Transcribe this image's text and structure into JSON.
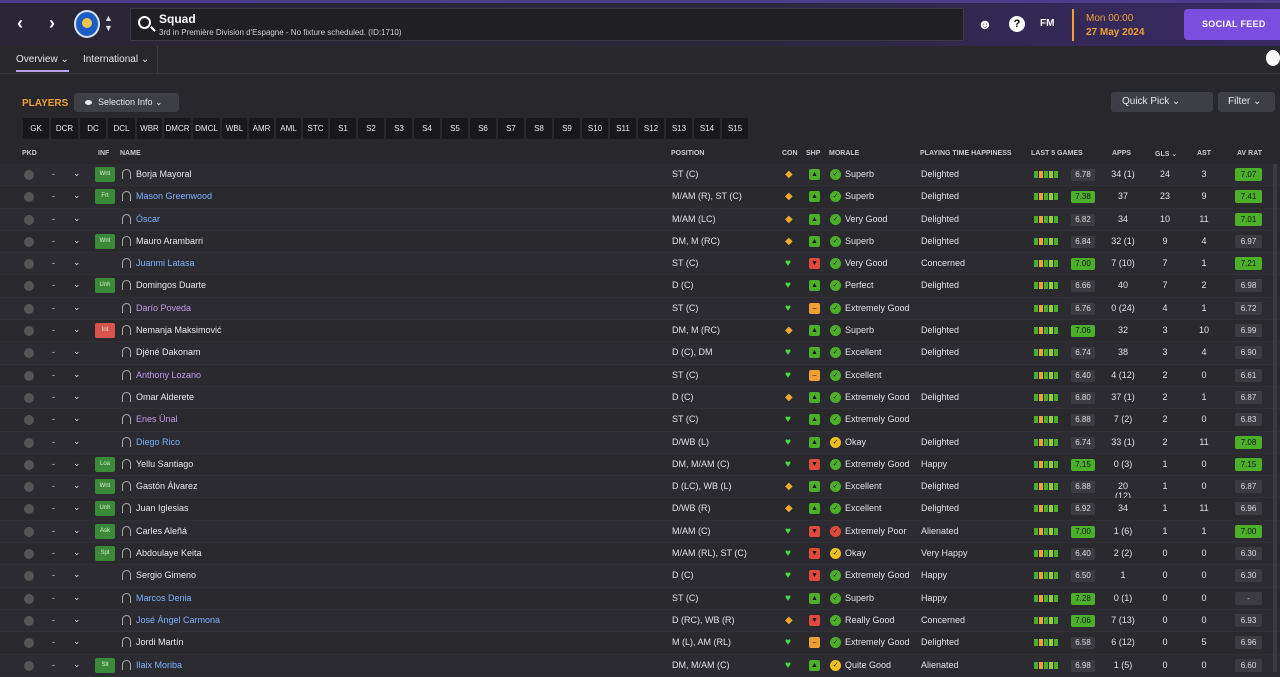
{
  "header": {
    "title": "Squad",
    "subtitle": "3rd in Première Division d'Espagne - No fixture scheduled. (ID:1710)",
    "fm_label": "FM",
    "help_label": "?",
    "date_line1": "Mon 00:00",
    "date_line2": "27 May 2024",
    "social_label": "SOCIAL FEED",
    "back_label": "‹",
    "forward_label": "›"
  },
  "tabs": [
    {
      "label": "Overview ⌄"
    },
    {
      "label": "International ⌄"
    }
  ],
  "toolbar": {
    "players_label": "PLAYERS",
    "selection_info": "Selection Info ⌄",
    "quick_pick": "Quick Pick   ⌄",
    "filter": "Filter ⌄"
  },
  "position_filters": [
    "GK",
    "DCR",
    "DC",
    "DCL",
    "WBR",
    "DMCR",
    "DMCL",
    "WBL",
    "AMR",
    "AML",
    "STC",
    "S1",
    "S2",
    "S3",
    "S4",
    "S5",
    "S6",
    "S7",
    "S8",
    "S9",
    "S10",
    "S11",
    "S12",
    "S13",
    "S14",
    "S15"
  ],
  "columns": {
    "pkd": "PKD",
    "inf": "INF",
    "name": "NAME",
    "position": "POSITION",
    "con": "CON",
    "shp": "SHP",
    "morale": "MORALE",
    "pth": "PLAYING TIME HAPPINESS",
    "last5": "LAST 5 GAMES",
    "apps": "APPS",
    "gls": "GLS ⌄",
    "ast": "AST",
    "avrat": "AV RAT"
  },
  "colors": {
    "accent": "#f0a030",
    "social": "#7c4ee0",
    "green": "#4caf2a",
    "red": "#e04a3a",
    "name_blue": "#7db3ff",
    "name_purple": "#c49cf0"
  },
  "players": [
    {
      "inf": "Wnt",
      "name": "Borja Mayoral",
      "name_color": "white",
      "position": "ST (C)",
      "con": "shield",
      "shp": "up",
      "morale": "Superb",
      "pth": "Delighted",
      "last5": "6.78",
      "apps": "34 (1)",
      "gls": "24",
      "ast": "3",
      "avrat": "7.07"
    },
    {
      "inf": "Frt",
      "name": "Mason Greenwood",
      "name_color": "blue",
      "position": "M/AM (R), ST (C)",
      "con": "shield",
      "shp": "up",
      "morale": "Superb",
      "pth": "Delighted",
      "last5": "7.38",
      "apps": "37",
      "gls": "23",
      "ast": "9",
      "avrat": "7.41"
    },
    {
      "inf": "",
      "name": "Óscar",
      "name_color": "blue",
      "position": "M/AM (LC)",
      "con": "shield",
      "shp": "up",
      "morale": "Very Good",
      "pth": "Delighted",
      "last5": "6.82",
      "apps": "34",
      "gls": "10",
      "ast": "11",
      "avrat": "7.01"
    },
    {
      "inf": "Wnt",
      "name": "Mauro Arambarri",
      "name_color": "white",
      "position": "DM, M (RC)",
      "con": "shield",
      "shp": "up",
      "morale": "Superb",
      "pth": "Delighted",
      "last5": "6.84",
      "apps": "32 (1)",
      "gls": "9",
      "ast": "4",
      "avrat": "6.97"
    },
    {
      "inf": "",
      "name": "Juanmi Latasa",
      "name_color": "blue",
      "position": "ST (C)",
      "con": "heart",
      "shp": "down",
      "morale": "Very Good",
      "pth": "Concerned",
      "last5": "7.00",
      "apps": "7 (10)",
      "gls": "7",
      "ast": "1",
      "avrat": "7.21"
    },
    {
      "inf": "Unh",
      "name": "Domingos Duarte",
      "name_color": "white",
      "position": "D (C)",
      "con": "heart",
      "shp": "up",
      "morale": "Perfect",
      "pth": "Delighted",
      "last5": "6.66",
      "apps": "40",
      "gls": "7",
      "ast": "2",
      "avrat": "6.98"
    },
    {
      "inf": "",
      "name": "Darío Poveda",
      "name_color": "purple",
      "position": "ST (C)",
      "con": "heart",
      "shp": "neutral",
      "morale": "Extremely Good",
      "pth": "",
      "last5": "6.76",
      "apps": "0 (24)",
      "gls": "4",
      "ast": "1",
      "avrat": "6.72"
    },
    {
      "inf": "Int",
      "name": "Nemanja Maksimović",
      "name_color": "white",
      "position": "DM, M (RC)",
      "con": "shield",
      "shp": "up",
      "morale": "Superb",
      "pth": "Delighted",
      "last5": "7.06",
      "apps": "32",
      "gls": "3",
      "ast": "10",
      "avrat": "6.99"
    },
    {
      "inf": "",
      "name": "Djéné Dakonam",
      "name_color": "white",
      "position": "D (C), DM",
      "con": "heart",
      "shp": "up",
      "morale": "Excellent",
      "pth": "Delighted",
      "last5": "6.74",
      "apps": "38",
      "gls": "3",
      "ast": "4",
      "avrat": "6.90"
    },
    {
      "inf": "",
      "name": "Anthony Lozano",
      "name_color": "purple",
      "position": "ST (C)",
      "con": "heart",
      "shp": "neutral",
      "morale": "Excellent",
      "pth": "",
      "last5": "6.40",
      "apps": "4 (12)",
      "gls": "2",
      "ast": "0",
      "avrat": "6.61"
    },
    {
      "inf": "",
      "name": "Omar Alderete",
      "name_color": "white",
      "position": "D (C)",
      "con": "shield",
      "shp": "up",
      "morale": "Extremely Good",
      "pth": "Delighted",
      "last5": "6.80",
      "apps": "37 (1)",
      "gls": "2",
      "ast": "1",
      "avrat": "6.87"
    },
    {
      "inf": "",
      "name": "Enes Ünal",
      "name_color": "purple",
      "position": "ST (C)",
      "con": "heart",
      "shp": "up",
      "morale": "Extremely Good",
      "pth": "",
      "last5": "6.88",
      "apps": "7 (2)",
      "gls": "2",
      "ast": "0",
      "avrat": "6.83"
    },
    {
      "inf": "",
      "name": "Diego Rico",
      "name_color": "blue",
      "position": "D/WB (L)",
      "con": "heart",
      "shp": "up",
      "morale": "Okay",
      "pth": "Delighted",
      "last5": "6.74",
      "apps": "33 (1)",
      "gls": "2",
      "ast": "11",
      "avrat": "7.08"
    },
    {
      "inf": "Loa",
      "name": "Yellu Santiago",
      "name_color": "white",
      "position": "DM, M/AM (C)",
      "con": "heart",
      "shp": "down",
      "morale": "Extremely Good",
      "pth": "Happy",
      "last5": "7.15",
      "apps": "0 (3)",
      "gls": "1",
      "ast": "0",
      "avrat": "7.15"
    },
    {
      "inf": "Wnt",
      "name": "Gastón Álvarez",
      "name_color": "white",
      "position": "D (LC), WB (L)",
      "con": "shield",
      "shp": "up",
      "morale": "Excellent",
      "pth": "Delighted",
      "last5": "6.88",
      "apps": "20 (12)",
      "gls": "1",
      "ast": "0",
      "avrat": "6.87"
    },
    {
      "inf": "Unh",
      "name": "Juan Iglesias",
      "name_color": "white",
      "position": "D/WB (R)",
      "con": "shield",
      "shp": "up",
      "morale": "Excellent",
      "pth": "Delighted",
      "last5": "6.92",
      "apps": "34",
      "gls": "1",
      "ast": "11",
      "avrat": "6.96"
    },
    {
      "inf": "Ask",
      "name": "Carles Aleñá",
      "name_color": "white",
      "position": "M/AM (C)",
      "con": "heart",
      "shp": "down",
      "morale": "Extremely Poor",
      "pth": "Alienated",
      "last5": "7.00",
      "apps": "1 (6)",
      "gls": "1",
      "ast": "1",
      "avrat": "7.00"
    },
    {
      "inf": "Spt",
      "name": "Abdoulaye Keita",
      "name_color": "white",
      "position": "M/AM (RL), ST (C)",
      "con": "heart",
      "shp": "down",
      "morale": "Okay",
      "pth": "Very Happy",
      "last5": "6.40",
      "apps": "2 (2)",
      "gls": "0",
      "ast": "0",
      "avrat": "6.30"
    },
    {
      "inf": "",
      "name": "Sergio Gimeno",
      "name_color": "white",
      "position": "D (C)",
      "con": "heart",
      "shp": "down",
      "morale": "Extremely Good",
      "pth": "Happy",
      "last5": "6.50",
      "apps": "1",
      "gls": "0",
      "ast": "0",
      "avrat": "6.30"
    },
    {
      "inf": "",
      "name": "Marcos Denia",
      "name_color": "blue",
      "position": "ST (C)",
      "con": "heart",
      "shp": "up",
      "morale": "Superb",
      "pth": "Happy",
      "last5": "7.28",
      "apps": "0 (1)",
      "gls": "0",
      "ast": "0",
      "avrat": "-"
    },
    {
      "inf": "",
      "name": "José Ángel Carmona",
      "name_color": "blue",
      "position": "D (RC), WB (R)",
      "con": "shield",
      "shp": "down",
      "morale": "Really Good",
      "pth": "Concerned",
      "last5": "7.06",
      "apps": "7 (13)",
      "gls": "0",
      "ast": "0",
      "avrat": "6.93"
    },
    {
      "inf": "",
      "name": "Jordi Martín",
      "name_color": "white",
      "position": "M (L), AM (RL)",
      "con": "heart",
      "shp": "neutral",
      "morale": "Extremely Good",
      "pth": "Delighted",
      "last5": "6.58",
      "apps": "6 (12)",
      "gls": "0",
      "ast": "5",
      "avrat": "6.96"
    },
    {
      "inf": "Slt",
      "name": "Ilaix Moriba",
      "name_color": "blue",
      "position": "DM, M/AM (C)",
      "con": "heart",
      "shp": "up",
      "morale": "Quite Good",
      "pth": "Alienated",
      "last5": "6.98",
      "apps": "1 (5)",
      "gls": "0",
      "ast": "0",
      "avrat": "6.60"
    }
  ]
}
